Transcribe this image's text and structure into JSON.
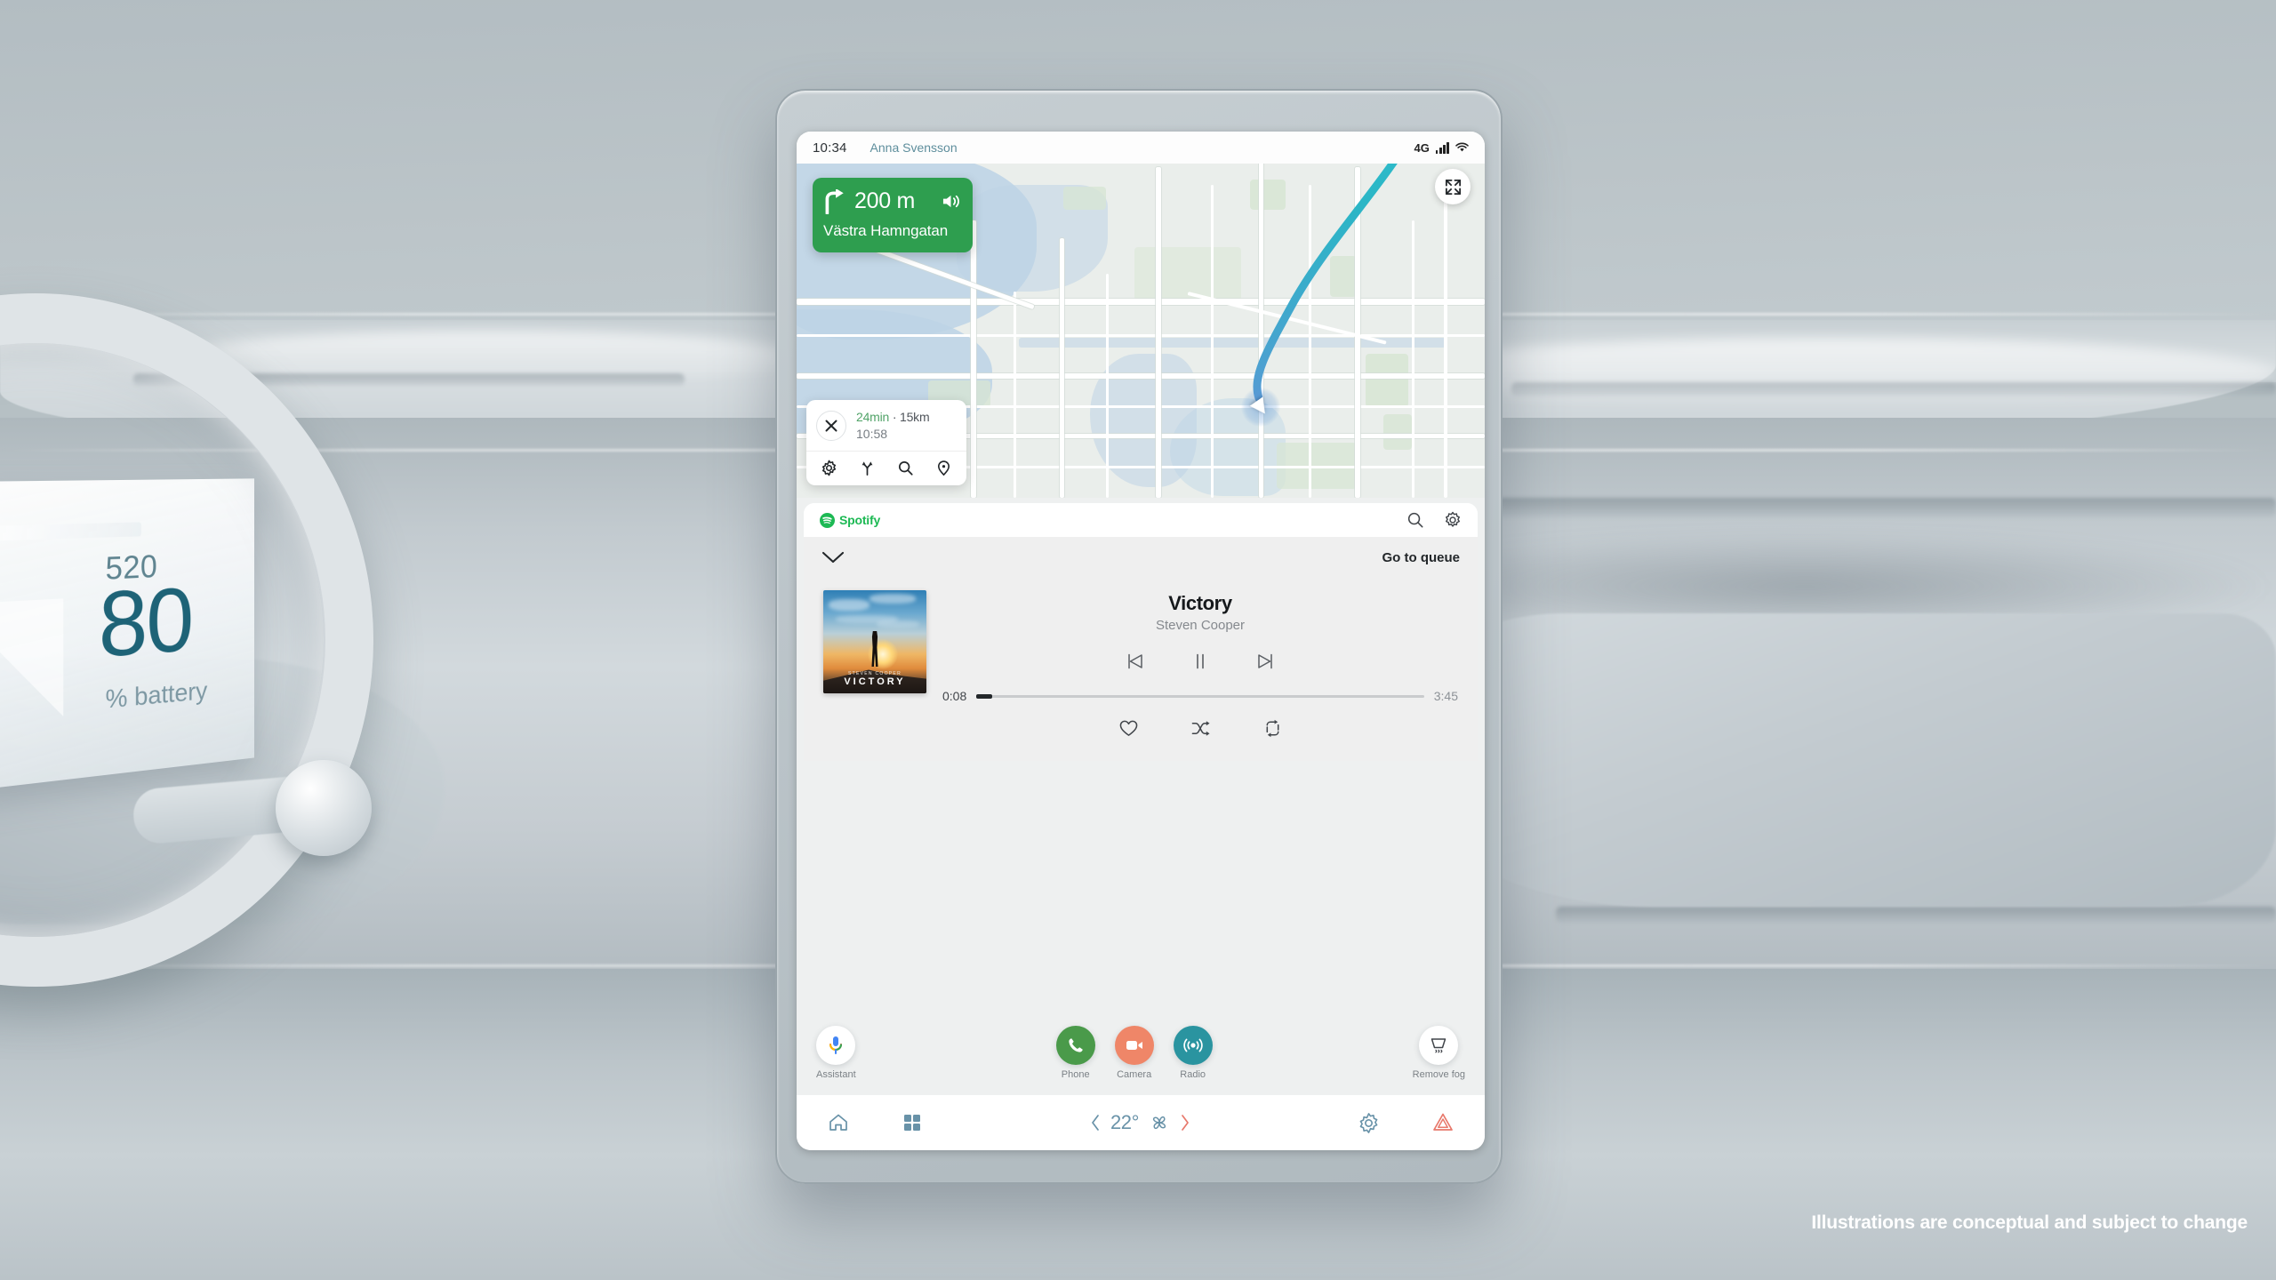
{
  "caption": "Illustrations are conceptual and subject to change",
  "cluster": {
    "range": "520",
    "soc": "80",
    "unit": "% battery"
  },
  "statusbar": {
    "time": "10:34",
    "user": "Anna Svensson",
    "network": "4G",
    "signal_icon": "signal-bars-icon",
    "wifi_icon": "wifi-icon"
  },
  "map": {
    "expand_icon": "expand-fullscreen-icon",
    "vehicle_icon": "vehicle-position-arrow-icon",
    "route_color": "#2bb6c6",
    "route_color_end": "#5d96d6",
    "nav_card": {
      "maneuver_icon": "turn-right-icon",
      "distance": "200 m",
      "street": "Västra Hamngatan",
      "sound_icon": "volume-on-icon",
      "color": "#2e9e4f"
    },
    "trip": {
      "close_icon": "close-x-icon",
      "duration": "24min",
      "separator": " · ",
      "distance": "15km",
      "arrival": "10:58",
      "duration_color": "#51a368",
      "actions": [
        {
          "icon": "settings-gear-icon",
          "name": "route-settings"
        },
        {
          "icon": "alternate-routes-icon",
          "name": "alternate-routes"
        },
        {
          "icon": "search-icon",
          "name": "search-destination"
        },
        {
          "icon": "location-pin-icon",
          "name": "saved-places"
        }
      ]
    }
  },
  "media": {
    "app_name": "Spotify",
    "app_color": "#1db954",
    "logo_icon": "spotify-logo-icon",
    "header_icons": [
      {
        "icon": "search-icon",
        "name": "media-search"
      },
      {
        "icon": "settings-gear-icon",
        "name": "media-settings"
      }
    ],
    "collapse_icon": "chevron-down-icon",
    "queue_label": "Go to queue",
    "album": {
      "cover_artist": "STEVEN COOPER",
      "cover_title": "VICTORY",
      "alt": "album-cover-art"
    },
    "track": {
      "title": "Victory",
      "artist": "Steven Cooper",
      "elapsed": "0:08",
      "duration": "3:45",
      "progress_percent": 3.5
    },
    "controls": [
      {
        "icon": "previous-track-icon",
        "name": "previous-track"
      },
      {
        "icon": "pause-icon",
        "name": "play-pause"
      },
      {
        "icon": "next-track-icon",
        "name": "next-track"
      }
    ],
    "extra_controls": [
      {
        "icon": "heart-icon",
        "name": "like-track"
      },
      {
        "icon": "shuffle-icon",
        "name": "shuffle"
      },
      {
        "icon": "repeat-icon",
        "name": "repeat"
      }
    ]
  },
  "dock": {
    "assistant": {
      "label": "Assistant",
      "icon": "microphone-icon",
      "bg": "#ffffff"
    },
    "apps": [
      {
        "label": "Phone",
        "icon": "phone-icon",
        "bg": "#4a9a4a"
      },
      {
        "label": "Camera",
        "icon": "camera-icon",
        "bg": "#ef8668"
      },
      {
        "label": "Radio",
        "icon": "radio-waves-icon",
        "bg": "#2a94a0"
      }
    ],
    "defrost": {
      "label": "Remove fog",
      "icon": "rear-defrost-icon",
      "bg": "#ffffff"
    }
  },
  "bottombar": {
    "home_icon": "home-icon",
    "apps_icon": "app-grid-icon",
    "temp_down_icon": "chevron-left-icon",
    "temperature": "22°",
    "fan_icon": "fan-icon",
    "temp_up_icon": "chevron-right-icon",
    "settings_icon": "settings-gear-icon",
    "hazard_icon": "hazard-warning-icon",
    "accent_blue": "#6892a8",
    "accent_red": "#e8786b"
  }
}
